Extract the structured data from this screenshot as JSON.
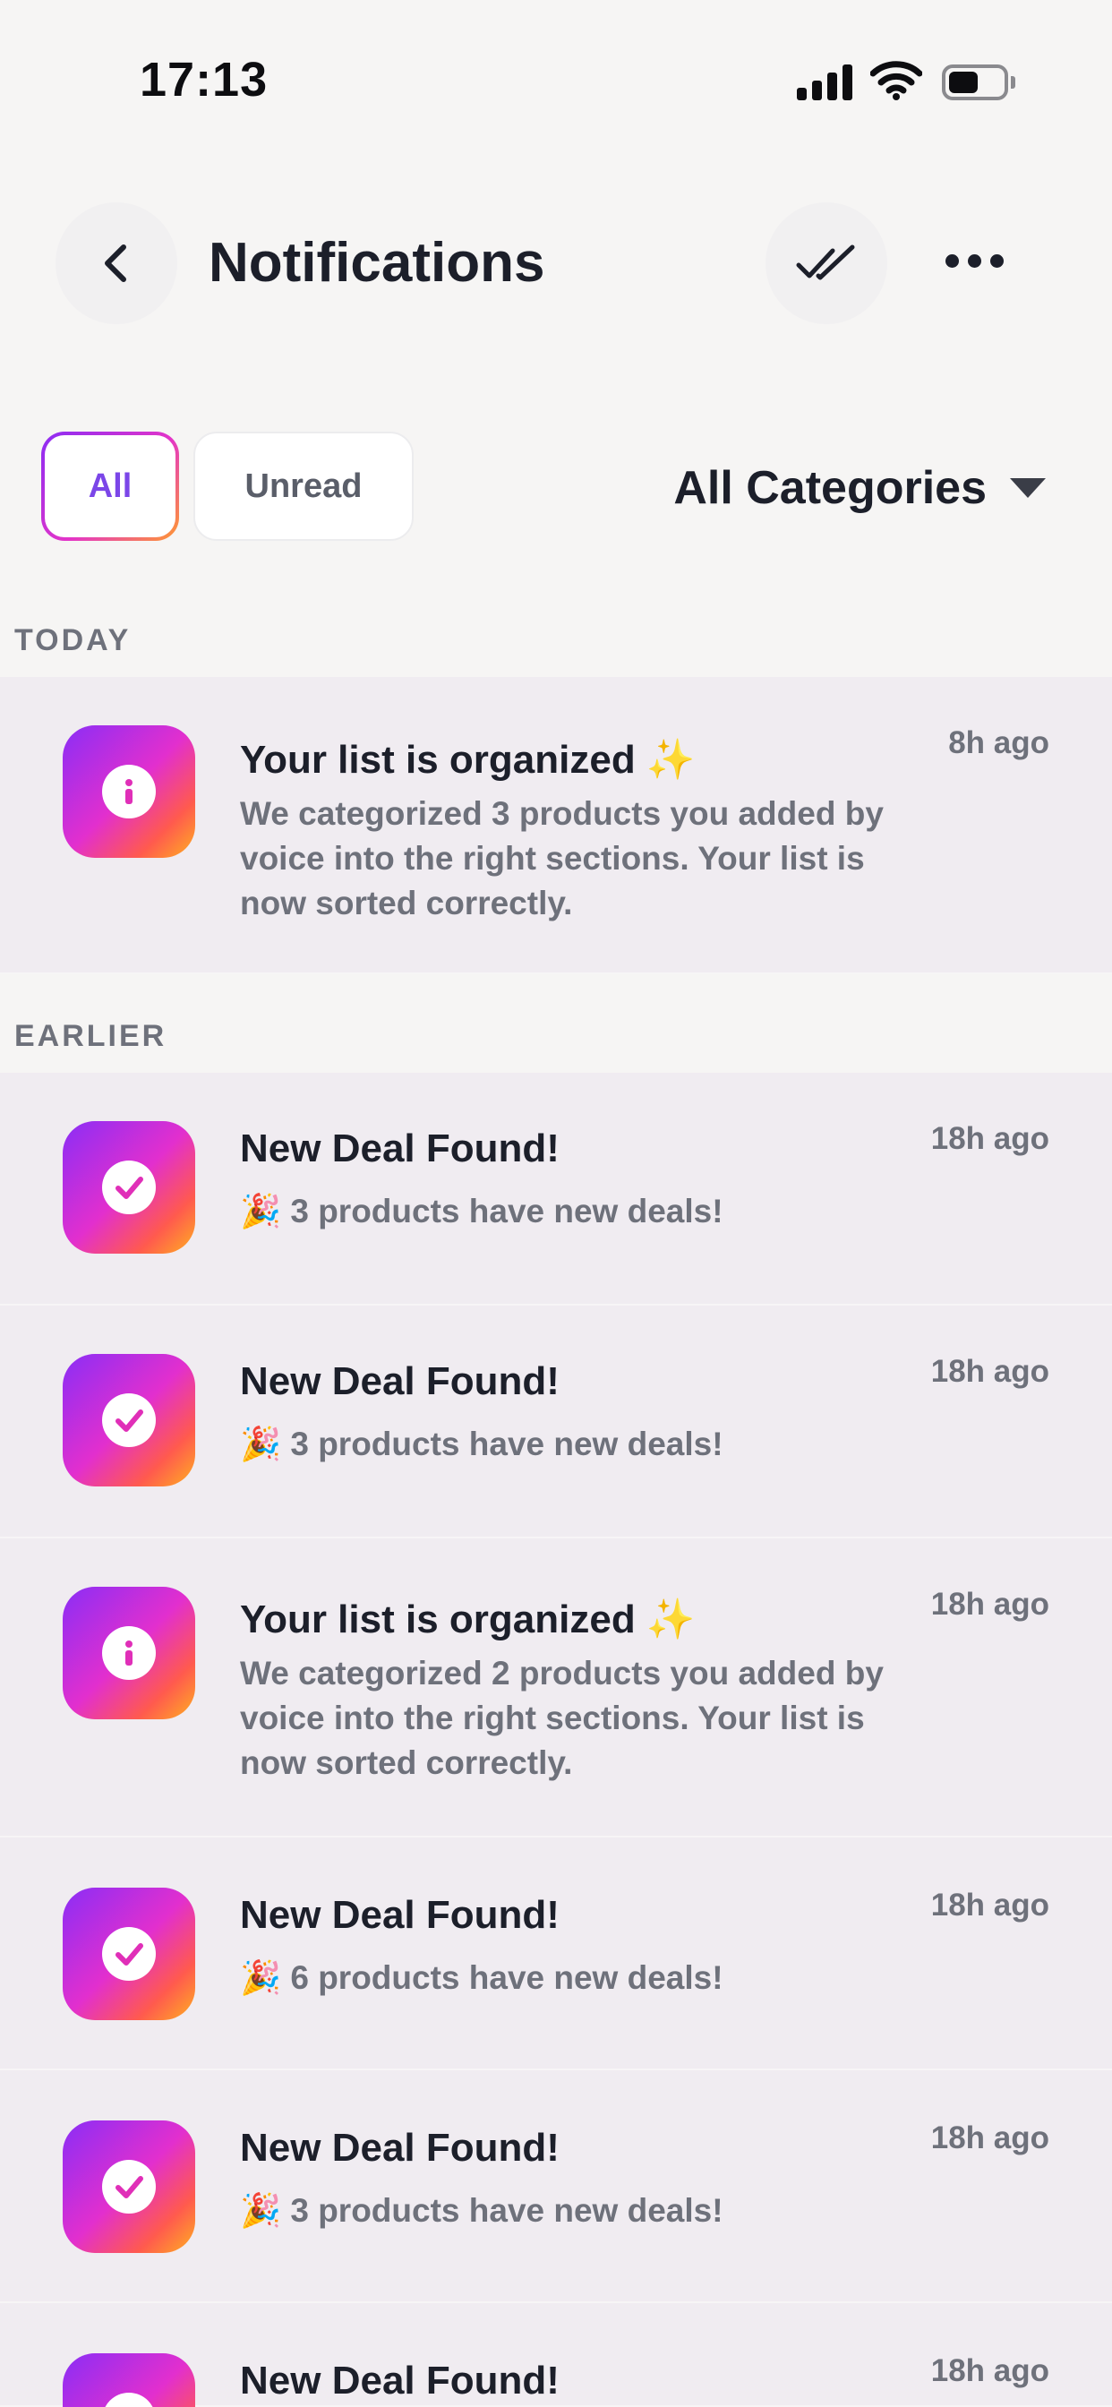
{
  "status_bar": {
    "time": "17:13"
  },
  "header": {
    "title": "Notifications"
  },
  "filters": {
    "all_label": "All",
    "unread_label": "Unread",
    "category_label": "All Categories"
  },
  "sections": {
    "today": "TODAY",
    "earlier": "EARLIER"
  },
  "notifications": [
    {
      "icon": "info-icon",
      "title": "Your list is organized ✨",
      "body": "We categorized 3 products you added by voice into the right sections. Your list is now sorted correctly.",
      "time": "8h ago"
    },
    {
      "icon": "check-icon",
      "title": "New Deal Found!",
      "body": "🎉 3 products have new deals!",
      "time": "18h ago"
    },
    {
      "icon": "check-icon",
      "title": "New Deal Found!",
      "body": "🎉 3 products have new deals!",
      "time": "18h ago"
    },
    {
      "icon": "info-icon",
      "title": "Your list is organized ✨",
      "body": "We categorized 2 products you added by voice into the right sections. Your list is now sorted correctly.",
      "time": "18h ago"
    },
    {
      "icon": "check-icon",
      "title": "New Deal Found!",
      "body": "🎉 6 products have new deals!",
      "time": "18h ago"
    },
    {
      "icon": "check-icon",
      "title": "New Deal Found!",
      "body": "🎉 3 products have new deals!",
      "time": "18h ago"
    },
    {
      "icon": "check-icon",
      "title": "New Deal Found!",
      "body": "",
      "time": "18h ago"
    }
  ],
  "colors": {
    "background": "#f6f5f4",
    "card": "#f0ecf1",
    "accent_purple": "#7b46e8",
    "gradient_start": "#8a2ef6",
    "gradient_mid": "#e22fce",
    "gradient_end": "#ffb021"
  }
}
